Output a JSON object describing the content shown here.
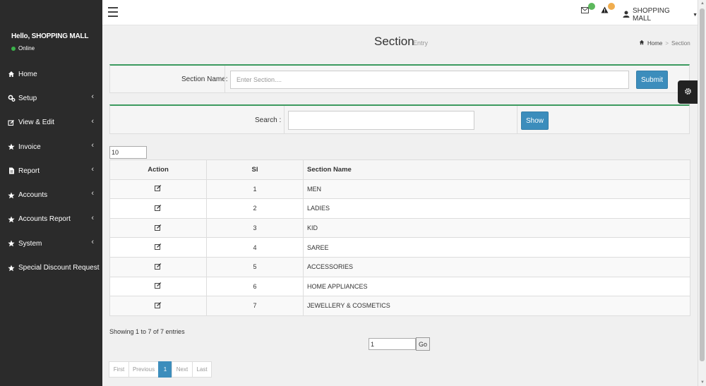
{
  "sidebar": {
    "greeting": "Hello, SHOPPING MALL",
    "status": "Online",
    "items": [
      {
        "label": "Home",
        "icon": "home-icon",
        "has_sub": false
      },
      {
        "label": "Setup",
        "icon": "cogs-icon",
        "has_sub": true
      },
      {
        "label": "View & Edit",
        "icon": "edit-icon",
        "has_sub": true
      },
      {
        "label": "Invoice",
        "icon": "star-icon",
        "has_sub": true
      },
      {
        "label": "Report",
        "icon": "file-icon",
        "has_sub": true
      },
      {
        "label": "Accounts",
        "icon": "star-icon",
        "has_sub": true
      },
      {
        "label": "Accounts Report",
        "icon": "star-icon",
        "has_sub": true
      },
      {
        "label": "System",
        "icon": "star-icon",
        "has_sub": true
      },
      {
        "label": "Special Discount Request",
        "icon": "star-icon",
        "has_sub": false
      }
    ]
  },
  "topbar": {
    "user": "SHOPPING MALL"
  },
  "page": {
    "title": "Section",
    "subtitle": "Entry",
    "breadcrumb_home": "Home",
    "breadcrumb_sep": ">",
    "breadcrumb_current": "Section"
  },
  "entry_form": {
    "label": "Section Name:",
    "placeholder": "Enter Section....",
    "submit": "Submit"
  },
  "search_form": {
    "label": "Search :",
    "value": "",
    "show": "Show"
  },
  "table": {
    "page_length": "10",
    "headers": [
      "Action",
      "Sl",
      "Section Name"
    ],
    "rows": [
      {
        "sl": "1",
        "name": "MEN"
      },
      {
        "sl": "2",
        "name": "LADIES"
      },
      {
        "sl": "3",
        "name": "KID"
      },
      {
        "sl": "4",
        "name": "SAREE"
      },
      {
        "sl": "5",
        "name": "ACCESSORIES"
      },
      {
        "sl": "6",
        "name": "HOME APPLIANCES"
      },
      {
        "sl": "7",
        "name": "JEWELLERY & COSMETICS"
      }
    ],
    "info": "Showing 1 to 7 of 7 entries"
  },
  "goto": {
    "value": "1",
    "button": "Go"
  },
  "pagination": {
    "first": "First",
    "previous": "Previous",
    "current": "1",
    "next": "Next",
    "last": "Last"
  },
  "colors": {
    "sidebar_bg": "#2b2b2b",
    "accent": "#3c8dbc",
    "box_border_top": "#3c9a5f",
    "online": "#3bb24a"
  }
}
